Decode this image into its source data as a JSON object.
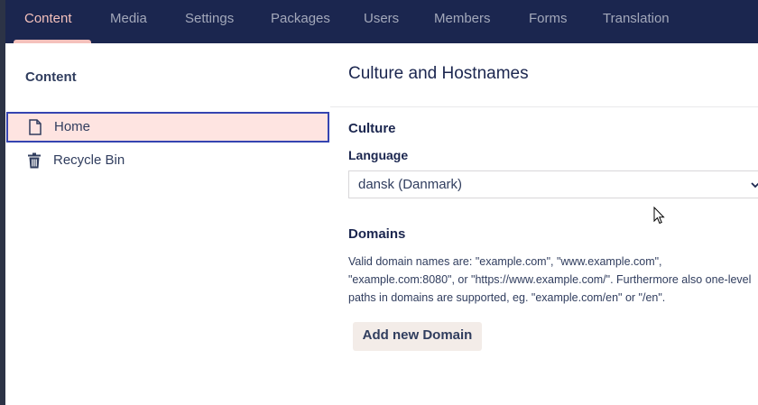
{
  "topnav": {
    "items": [
      {
        "label": "Content"
      },
      {
        "label": "Media"
      },
      {
        "label": "Settings"
      },
      {
        "label": "Packages"
      },
      {
        "label": "Users"
      },
      {
        "label": "Members"
      },
      {
        "label": "Forms"
      },
      {
        "label": "Translation"
      }
    ],
    "active": "Content"
  },
  "tree": {
    "title": "Content",
    "nodes": [
      {
        "label": "Home",
        "icon": "document-icon",
        "selected": true
      },
      {
        "label": "Recycle Bin",
        "icon": "trash-icon",
        "selected": false
      }
    ]
  },
  "panel": {
    "title": "Culture and Hostnames",
    "culture": {
      "title": "Culture",
      "language_label": "Language",
      "language_value": "dansk (Danmark)"
    },
    "domains": {
      "title": "Domains",
      "help_line1": "Valid domain names are: \"example.com\", \"www.example.com\",",
      "help_line2": "\"example.com:8080\", or \"https://www.example.com/\". Furthermore also one-level",
      "help_line3": "paths in domains are supported, eg. \"example.com/en\" or \"/en\".",
      "add_button": "Add new Domain"
    }
  },
  "colors": {
    "nav_bg": "#1b264f",
    "nav_active": "#f5c1bc",
    "selected_bg": "#fee4e1",
    "selected_border": "#3544b1",
    "button_bg": "#f3ece8"
  }
}
